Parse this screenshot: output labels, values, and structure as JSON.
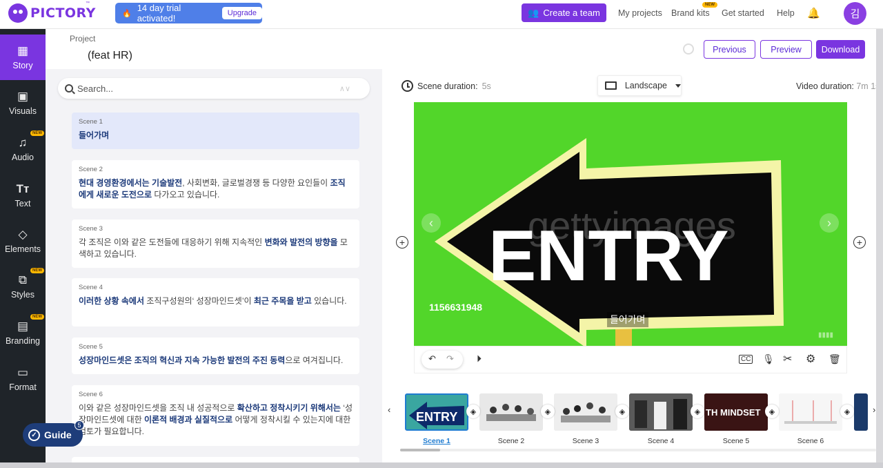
{
  "app": {
    "logo_text": "PICTORY",
    "logo_tm": "™"
  },
  "topbar": {
    "trial_text": "14 day trial activated!",
    "upgrade_label": "Upgrade",
    "create_team_label": "Create a team",
    "nav": [
      "My projects",
      "Brand kits",
      "Get started",
      "Help"
    ],
    "brand_kits_badge": "NEW",
    "avatar_initial": "김"
  },
  "sidebar": {
    "items": [
      {
        "label": "Story",
        "icon": "story-icon",
        "new": false,
        "active": true
      },
      {
        "label": "Visuals",
        "icon": "image-icon",
        "new": false,
        "active": false
      },
      {
        "label": "Audio",
        "icon": "music-icon",
        "new": true,
        "active": false
      },
      {
        "label": "Text",
        "icon": "text-icon",
        "new": false,
        "active": false
      },
      {
        "label": "Elements",
        "icon": "shapes-icon",
        "new": false,
        "active": false
      },
      {
        "label": "Styles",
        "icon": "styles-icon",
        "new": true,
        "active": false
      },
      {
        "label": "Branding",
        "icon": "branding-icon",
        "new": true,
        "active": false
      },
      {
        "label": "Format",
        "icon": "format-icon",
        "new": false,
        "active": false
      }
    ],
    "new_badge": "NEW"
  },
  "project": {
    "label": "Project",
    "title": "(feat HR)",
    "previous_label": "Previous",
    "preview_label": "Preview",
    "download_label": "Download"
  },
  "search": {
    "placeholder": "Search..."
  },
  "scenes": [
    {
      "label": "Scene 1",
      "html": "<b>들어가며</b>"
    },
    {
      "label": "Scene 2",
      "html": "<b>현대 경영환경에서는 기술발전</b>, 사회변화, 글로벌경쟁 등 다양한 요인들이 <b>조직에게 새로운 도전으로</b> 다가오고 있습니다."
    },
    {
      "label": "Scene 3",
      "html": "각 조직은 이와 같은 도전들에 대응하기 위해 지속적인 <b>변화와 발전의 방향을</b> 모색하고 있습니다."
    },
    {
      "label": "Scene 4",
      "html": "<b>이러한 상황 속에서</b> 조직구성원의‘ 성장마인드셋’이 <b>최근 주목을 받고</b> 있습니다."
    },
    {
      "label": "Scene 5",
      "html": "<b>성장마인드셋은 조직의 혁신과 지속 가능한 발전의 주진 동력</b>으로 여겨집니다."
    },
    {
      "label": "Scene 6",
      "html": "이와 같은 성장마인드셋을 조직 내 성공적으로 <b>확산하고 정착시키기 위해서는</b> ‘성장마인드셋에 대한 <b>이론적 배경과 실질적으로</b> 어떻게 정착시킬 수 있는지에 대한 검토가 필요합니다."
    }
  ],
  "guide": {
    "label": "Guide",
    "count": "5"
  },
  "editor": {
    "scene_duration_label": "Scene duration:",
    "scene_duration_value": "5s",
    "layout_value": "Landscape",
    "video_duration_label": "Video duration:",
    "video_duration_value": "7m 1s",
    "preview_image": {
      "watermark": "gettyimages",
      "sign_text": "ENTRY",
      "stock_id": "1156631948"
    },
    "caption": "들어가며"
  },
  "timeline": {
    "thumbs": [
      {
        "label": "Scene 1",
        "active": true,
        "kind": "entry",
        "text": "ENTRY"
      },
      {
        "label": "Scene 2",
        "active": false,
        "kind": "meeting"
      },
      {
        "label": "Scene 3",
        "active": false,
        "kind": "meeting2"
      },
      {
        "label": "Scene 4",
        "active": false,
        "kind": "people"
      },
      {
        "label": "Scene 5",
        "active": false,
        "kind": "text",
        "text": "TH MINDSET"
      },
      {
        "label": "Scene 6",
        "active": false,
        "kind": "white"
      }
    ]
  },
  "colors": {
    "brand": "#7a35e0",
    "sidebar": "#1f2429",
    "green_screen": "#52d62a",
    "trial": "#4f7fe8",
    "active_blue": "#1e7bd0"
  }
}
